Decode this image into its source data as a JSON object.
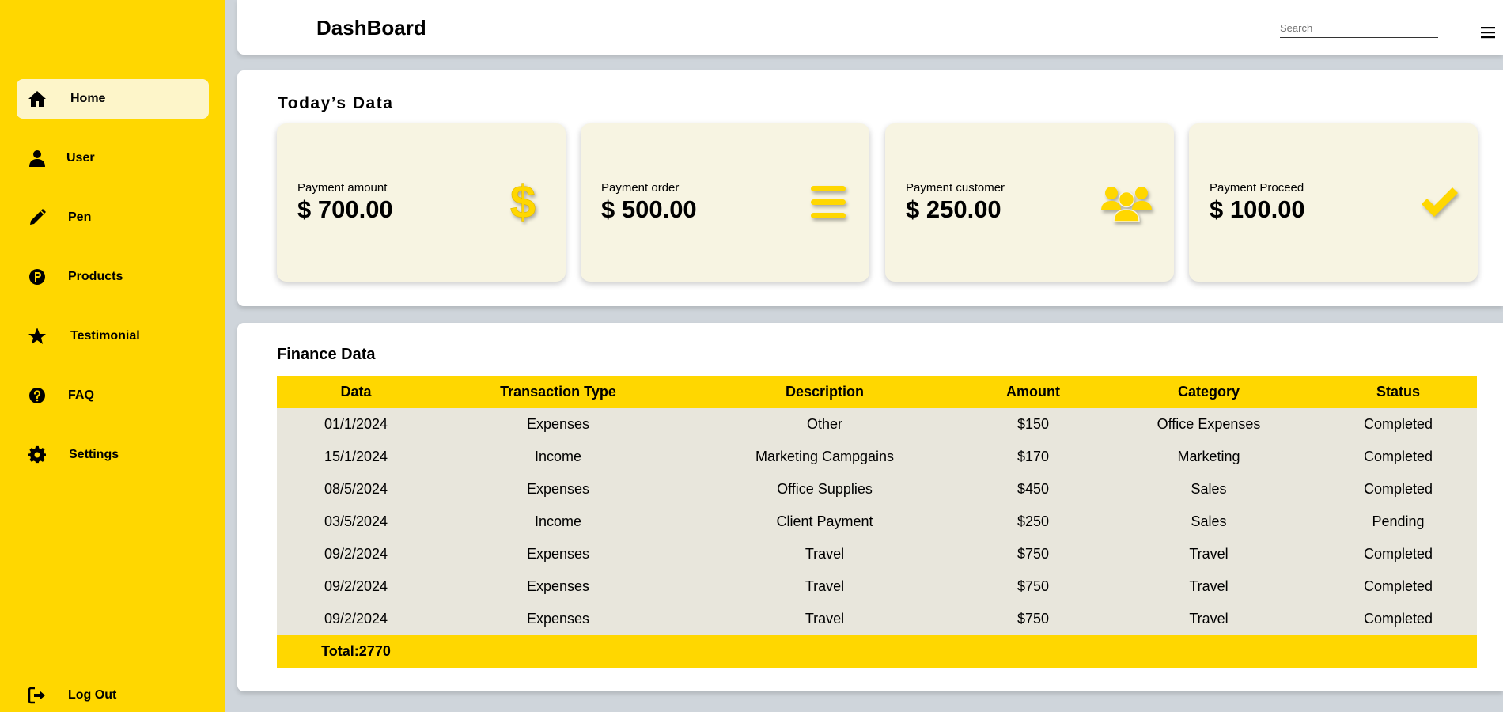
{
  "sidebar": {
    "items": [
      {
        "label": "Home",
        "icon": "home-icon",
        "active": true
      },
      {
        "label": "User",
        "icon": "user-icon"
      },
      {
        "label": "Pen",
        "icon": "pen-icon"
      },
      {
        "label": "Products",
        "icon": "products-icon"
      },
      {
        "label": "Testimonial",
        "icon": "star-icon"
      },
      {
        "label": "FAQ",
        "icon": "question-icon"
      },
      {
        "label": "Settings",
        "icon": "gear-icon"
      }
    ],
    "logout": {
      "label": "Log Out",
      "icon": "logout-icon"
    }
  },
  "header": {
    "title": "DashBoard",
    "search_placeholder": "Search"
  },
  "today": {
    "title": "Today’s Data",
    "cards": [
      {
        "label": "Payment amount",
        "value": "$ 700.00",
        "icon": "dollar-icon"
      },
      {
        "label": "Payment order",
        "value": "$ 500.00",
        "icon": "bars-icon"
      },
      {
        "label": "Payment customer",
        "value": "$ 250.00",
        "icon": "users-icon"
      },
      {
        "label": "Payment Proceed",
        "value": "$ 100.00",
        "icon": "check-icon"
      }
    ]
  },
  "finance": {
    "title": "Finance Data",
    "columns": [
      "Data",
      "Transaction Type",
      "Description",
      "Amount",
      "Category",
      "Status"
    ],
    "rows": [
      [
        "01/1/2024",
        "Expenses",
        "Other",
        "$150",
        "Office Expenses",
        "Completed"
      ],
      [
        "15/1/2024",
        "Income",
        "Marketing Campgains",
        "$170",
        "Marketing",
        "Completed"
      ],
      [
        "08/5/2024",
        "Expenses",
        "Office Supplies",
        "$450",
        "Sales",
        "Completed"
      ],
      [
        "03/5/2024",
        "Income",
        "Client Payment",
        "$250",
        "Sales",
        "Pending"
      ],
      [
        "09/2/2024",
        "Expenses",
        "Travel",
        "$750",
        "Travel",
        "Completed"
      ],
      [
        "09/2/2024",
        "Expenses",
        "Travel",
        "$750",
        "Travel",
        "Completed"
      ],
      [
        "09/2/2024",
        "Expenses",
        "Travel",
        "$750",
        "Travel",
        "Completed"
      ]
    ],
    "total": "Total:2770"
  },
  "colors": {
    "accent": "#ffd700",
    "active_item": "#fdf5c9",
    "card_bg": "#f7f4e2",
    "row_bg": "#e8e6dc",
    "page_bg": "#cfd5db"
  }
}
